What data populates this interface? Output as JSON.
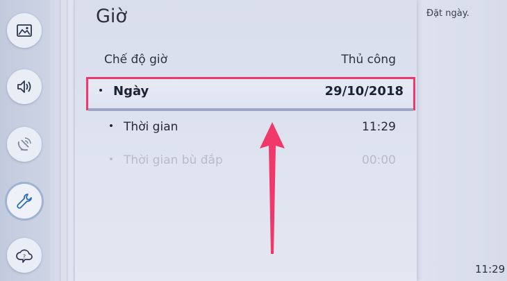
{
  "section_title": "Giờ",
  "settings": {
    "mode": {
      "label": "Chế độ giờ",
      "value": "Thủ công"
    },
    "date": {
      "label": "Ngày",
      "value": "29/10/2018"
    },
    "time": {
      "label": "Thời gian",
      "value": "11:29"
    },
    "offset": {
      "label": "Thời gian bù đắp",
      "value": "00:00"
    }
  },
  "help_text": "Đặt ngày.",
  "clock": "11:29",
  "sidebar_icons": [
    "picture-icon",
    "sound-icon",
    "broadcast-icon",
    "general-icon",
    "support-icon"
  ],
  "colors": {
    "highlight": "#f0386a",
    "arrow": "#f0386a"
  }
}
